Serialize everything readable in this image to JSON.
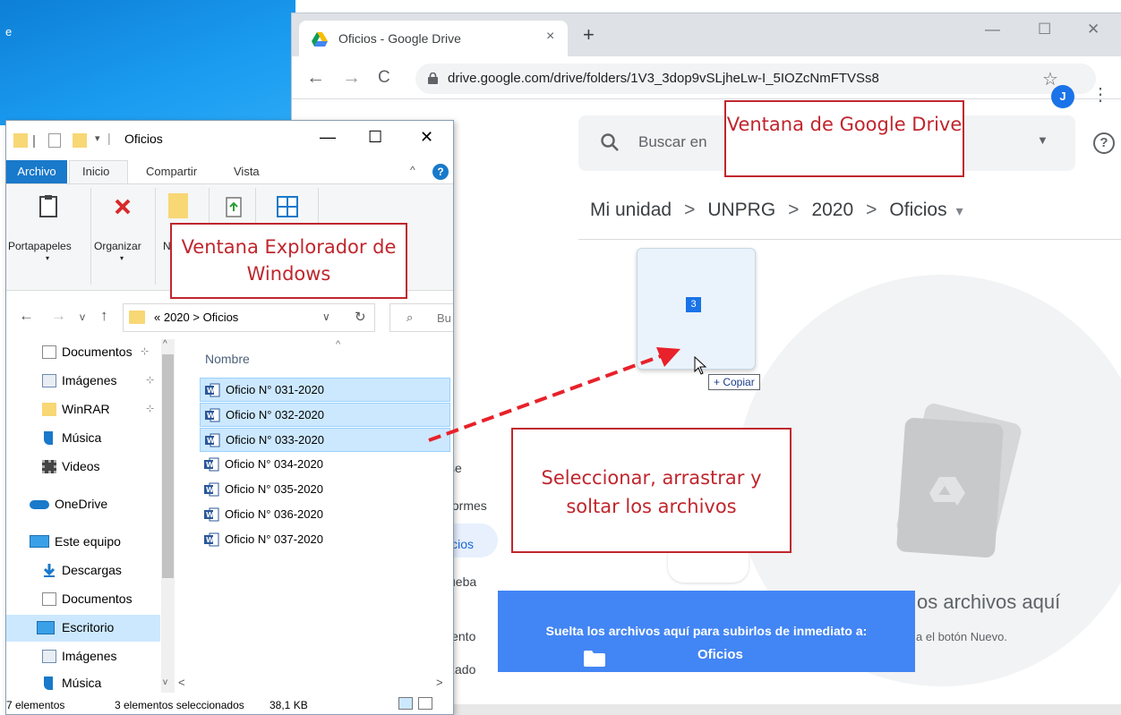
{
  "desktop": {
    "label": "e"
  },
  "chrome": {
    "tab_title": "Oficios - Google Drive",
    "tab_close": "×",
    "new_tab": "+",
    "window_buttons": [
      "—",
      "☐",
      "✕"
    ],
    "nav": {
      "back": "←",
      "forward": "→",
      "reload": "C"
    },
    "url": "drive.google.com/drive/folders/1V3_3dop9vSLjheLw-I_5IOZcNmFTVSs8",
    "star": "☆",
    "profile_initial": "J",
    "menu": "⋮"
  },
  "drive": {
    "search_placeholder": "Buscar en",
    "search_caret": "▼",
    "help": "?",
    "breadcrumb": [
      "Mi unidad",
      "UNPRG",
      "2020",
      "Oficios"
    ],
    "breadcrumb_sep": ">",
    "breadcrumb_caret": "▾",
    "sidebar_fragments": [
      "se",
      "formes",
      "icios",
      "ueba",
      "iento",
      "zado"
    ],
    "drag_count": "3",
    "copy_badge": "+ Copiar",
    "empty_title": "os archivos aquí",
    "empty_sub": "a el botón Nuevo.",
    "drop_text": "Suelta los archivos aquí para subirlos de inmediato a:",
    "drop_folder": "Oficios"
  },
  "annotations": {
    "drive_window": "Ventana de Google Drive",
    "explorer_window": "Ventana Explorador de Windows",
    "instruction": "Seleccionar, arrastrar y soltar los archivos"
  },
  "explorer": {
    "title": "Oficios",
    "qa_separator": "|",
    "qa_caret": "▾",
    "window_buttons": [
      "—",
      "☐",
      "✕"
    ],
    "tabs": [
      "Archivo",
      "Inicio",
      "Compartir",
      "Vista"
    ],
    "collapse": "^",
    "help": "?",
    "ribbon": [
      {
        "label": "Portapapeles",
        "icon": "clipboard-icon"
      },
      {
        "label": "Organizar",
        "icon": "delete-icon"
      },
      {
        "label": "N",
        "icon": "new-folder-icon"
      }
    ],
    "ribbon_caret": "▾",
    "address": {
      "back": "←",
      "forward": "→",
      "history": "v",
      "up": "↑",
      "path": "« 2020 > Oficios",
      "dropdown": "∨",
      "refresh": "↻",
      "search_icon": "⌕",
      "search_placeholder": "Bu"
    },
    "nav_items": [
      {
        "label": "Documentos",
        "icon": "documents-icon",
        "pinned": true
      },
      {
        "label": "Imágenes",
        "icon": "pictures-icon",
        "pinned": true
      },
      {
        "label": "WinRAR",
        "icon": "folder-icon",
        "pinned": true
      },
      {
        "label": "Música",
        "icon": "music-icon",
        "pinned": false
      },
      {
        "label": "Videos",
        "icon": "videos-icon",
        "pinned": false
      },
      {
        "label": "OneDrive",
        "icon": "onedrive-icon",
        "pinned": false
      },
      {
        "label": "Este equipo",
        "icon": "computer-icon",
        "pinned": false
      },
      {
        "label": "Descargas",
        "icon": "downloads-icon",
        "pinned": false
      },
      {
        "label": "Documentos",
        "icon": "documents-icon",
        "pinned": false
      },
      {
        "label": "Escritorio",
        "icon": "desktop-icon",
        "pinned": false
      },
      {
        "label": "Imágenes",
        "icon": "pictures-icon",
        "pinned": false
      },
      {
        "label": "Música",
        "icon": "music-icon",
        "pinned": false
      }
    ],
    "pin_glyph": "⊹",
    "scroll_up": "^",
    "scroll_down": "v",
    "column_header": "Nombre",
    "sort_caret": "^",
    "files": [
      {
        "name": "Oficio N° 031-2020",
        "selected": true
      },
      {
        "name": "Oficio N° 032-2020",
        "selected": true
      },
      {
        "name": "Oficio N° 033-2020",
        "selected": true
      },
      {
        "name": "Oficio N° 034-2020",
        "selected": false
      },
      {
        "name": "Oficio N° 035-2020",
        "selected": false
      },
      {
        "name": "Oficio N° 036-2020",
        "selected": false
      },
      {
        "name": "Oficio N° 037-2020",
        "selected": false
      }
    ],
    "hscroll_left": "<",
    "hscroll_right": ">",
    "status": {
      "count": "7 elementos",
      "selection": "3 elementos seleccionados",
      "size": "38,1 KB"
    }
  },
  "colors": {
    "annotation": "#c0262d",
    "drop_banner": "#4285f4",
    "selection": "#cce8ff",
    "drag_arrow": "#e8212a"
  }
}
